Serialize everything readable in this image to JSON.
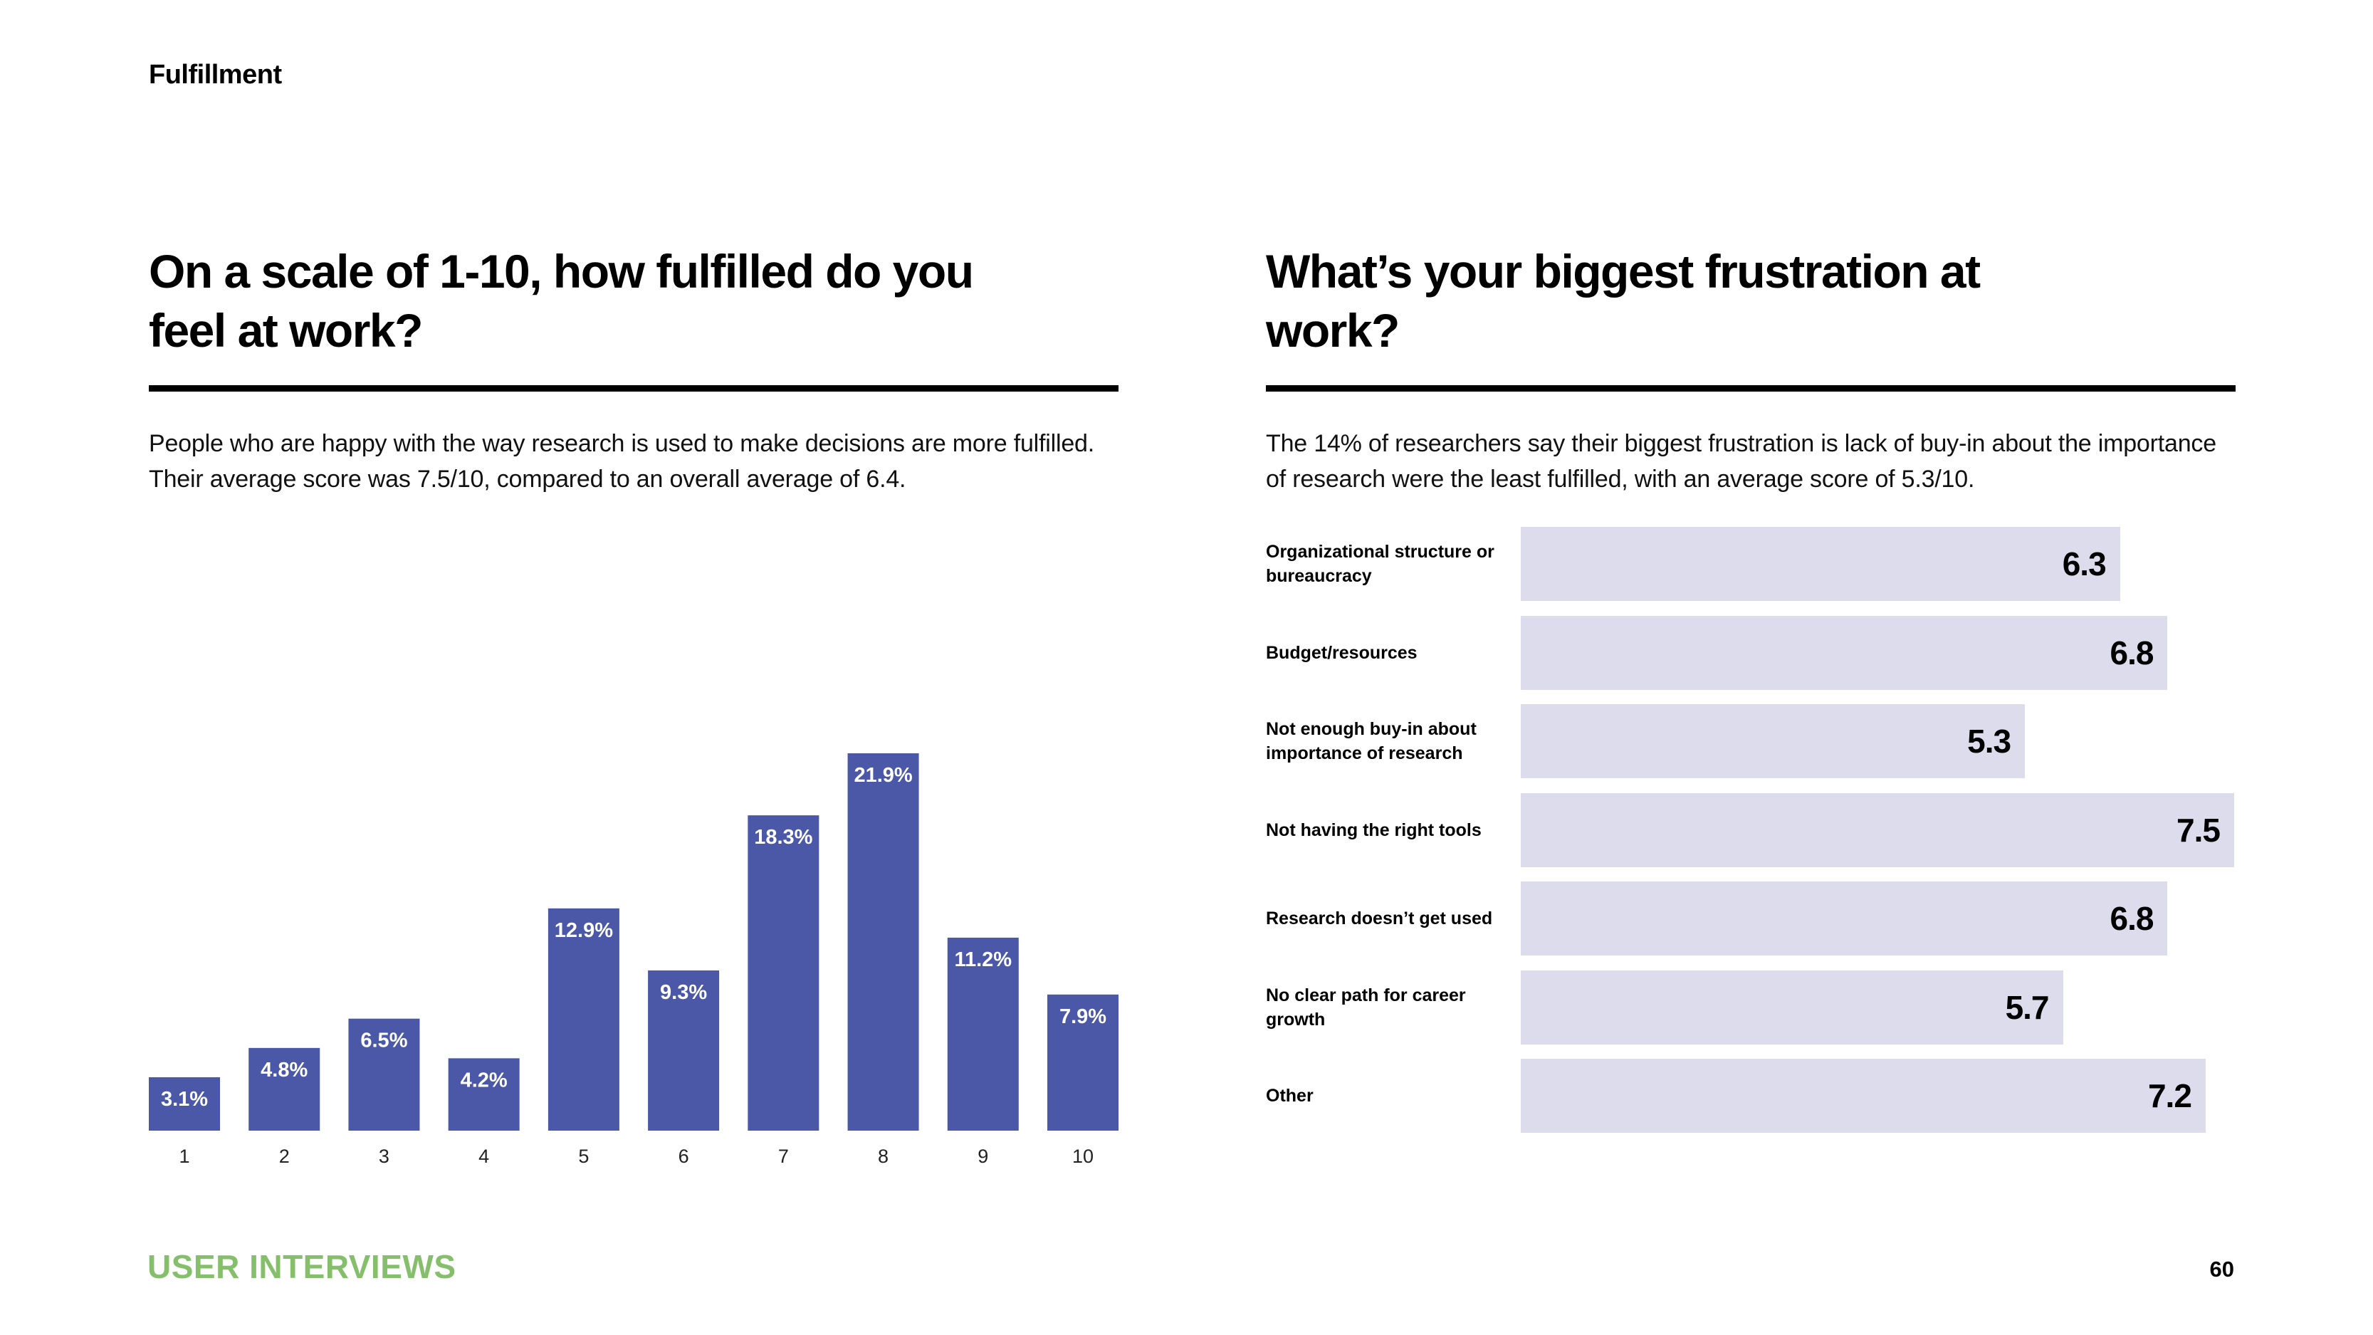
{
  "section": "Fulfillment",
  "left": {
    "question": "On a scale of 1-10, how fulfilled do you feel at work?",
    "body": "People who are happy with the way research is used to make decisions are more fulfilled. Their average score was 7.5/10, compared to an overall average of 6.4."
  },
  "right": {
    "question": "What’s your biggest frustration at work?",
    "body": "The 14% of researchers say their biggest frustration is lack of buy-in about the importance of research were the least fulfilled, with an average score of 5.3/10."
  },
  "footer": {
    "brand": "USER INTERVIEWS",
    "page_number": "60"
  },
  "colors": {
    "bar": "#4b58a8",
    "hbar": "#dcdcec",
    "brand": "#86bf6b"
  },
  "chart_data": [
    {
      "type": "bar",
      "title": "On a scale of 1-10, how fulfilled do you feel at work?",
      "xlabel": "",
      "ylabel": "",
      "categories": [
        "1",
        "2",
        "3",
        "4",
        "5",
        "6",
        "7",
        "8",
        "9",
        "10"
      ],
      "values": [
        3.1,
        4.8,
        6.5,
        4.2,
        12.9,
        9.3,
        18.3,
        21.9,
        11.2,
        7.9
      ],
      "value_labels": [
        "3.1%",
        "4.8%",
        "6.5%",
        "4.2%",
        "12.9%",
        "9.3%",
        "18.3%",
        "21.9%",
        "11.2%",
        "7.9%"
      ],
      "unit": "%",
      "ylim": [
        0,
        21.9
      ],
      "grid": false,
      "legend": "none"
    },
    {
      "type": "bar",
      "orientation": "horizontal",
      "title": "What’s your biggest frustration at work?",
      "categories": [
        "Organizational structure or bureaucracy",
        "Budget/resources",
        "Not enough buy-in about importance of research",
        "Not having the right tools",
        "Research doesn’t get used",
        "No clear path for career growth",
        "Other"
      ],
      "values": [
        6.3,
        6.8,
        5.3,
        7.5,
        6.8,
        5.7,
        7.2
      ],
      "value_labels": [
        "6.3",
        "6.8",
        "5.3",
        "7.5",
        "6.8",
        "5.7",
        "7.2"
      ],
      "xlim": [
        0,
        7.5
      ],
      "grid": false,
      "legend": "none"
    }
  ]
}
